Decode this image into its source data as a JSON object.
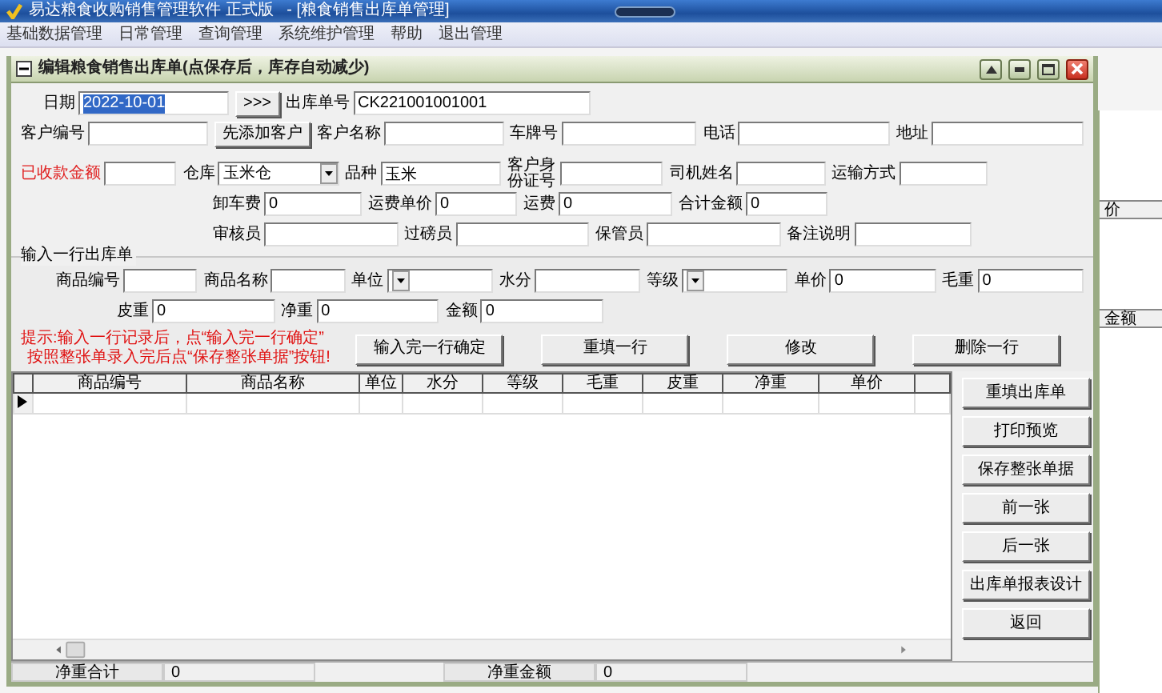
{
  "window": {
    "title": "易达粮食收购销售管理软件 正式版   - [粮食销售出库单管理]"
  },
  "menu": [
    "基础数据管理",
    "日常管理",
    "查询管理",
    "系统维护管理",
    "帮助",
    "退出管理"
  ],
  "background_grid": {
    "columns": [
      "价",
      "金额"
    ]
  },
  "child_window": {
    "title": "编辑粮食销售出库单(点保存后，库存自动减少)"
  },
  "header": {
    "date": {
      "label": "日期",
      "value": "2022-10-01",
      "text_selected": true
    },
    "more_button": ">>>",
    "order_no": {
      "label": "出库单号",
      "value": "CK221001001001"
    }
  },
  "form_rows": [
    [
      {
        "kind": "text",
        "label": "客户编号"
      },
      {
        "kind": "button",
        "label": "先添加客户"
      },
      {
        "kind": "text",
        "label": "客户名称"
      },
      {
        "kind": "text",
        "label": "车牌号"
      },
      {
        "kind": "text",
        "label": "电话"
      },
      {
        "kind": "text",
        "label": "地址"
      }
    ],
    [
      {
        "kind": "warn-text",
        "label": "已收款金额"
      },
      {
        "kind": "select",
        "label": "仓库",
        "value": "玉米仓"
      },
      {
        "kind": "text",
        "label": "品种",
        "value": "玉米"
      },
      {
        "kind": "stacked",
        "label": "客户身份证号"
      },
      {
        "kind": "text",
        "label": "司机姓名"
      },
      {
        "kind": "text",
        "label": "运输方式"
      }
    ],
    [
      {
        "kind": "text",
        "label": "卸车费",
        "value": "0"
      },
      {
        "kind": "text",
        "label": "运费单价",
        "value": "0"
      },
      {
        "kind": "text",
        "label": "运费",
        "value": "0"
      },
      {
        "kind": "text",
        "label": "合计金额",
        "value": "0"
      }
    ],
    [
      {
        "kind": "text",
        "label": "审核员"
      },
      {
        "kind": "text",
        "label": "过磅员"
      },
      {
        "kind": "text",
        "label": "保管员"
      },
      {
        "kind": "text",
        "label": "备注说明"
      }
    ]
  ],
  "entry_group": {
    "title": "输入一行出库单",
    "rows": [
      [
        {
          "kind": "text",
          "label": "商品编号"
        },
        {
          "kind": "text",
          "label": "商品名称"
        },
        {
          "kind": "select",
          "label": "单位"
        },
        {
          "kind": "text",
          "label": "水分"
        },
        {
          "kind": "select",
          "label": "等级"
        },
        {
          "kind": "text",
          "label": "单价",
          "value": "0"
        },
        {
          "kind": "text",
          "label": "毛重",
          "value": "0"
        }
      ],
      [
        {
          "kind": "text",
          "label": "皮重",
          "value": "0"
        },
        {
          "kind": "text",
          "label": "净重",
          "value": "0"
        },
        {
          "kind": "text",
          "label": "金额",
          "value": "0"
        }
      ]
    ]
  },
  "hint": [
    "提示:输入一行记录后，点“输入完一行确定”",
    "按照整张单录入完后点“保存整张单据”按钮!"
  ],
  "entry_buttons": [
    "输入完一行确定",
    "重填一行",
    "修改",
    "删除一行"
  ],
  "grid": {
    "columns": [
      "商品编号",
      "商品名称",
      "单位",
      "水分",
      "等级",
      "毛重",
      "皮重",
      "净重",
      "单价"
    ],
    "rows": [
      {
        "current": true
      }
    ]
  },
  "side_buttons": [
    "重填出库单",
    "打印预览",
    "保存整张单据",
    "前一张",
    "后一张",
    "出库单报表设计",
    "返回"
  ],
  "totals": [
    {
      "label": "净重合计",
      "value": "0"
    },
    {
      "label": "净重金额",
      "value": "0"
    }
  ]
}
